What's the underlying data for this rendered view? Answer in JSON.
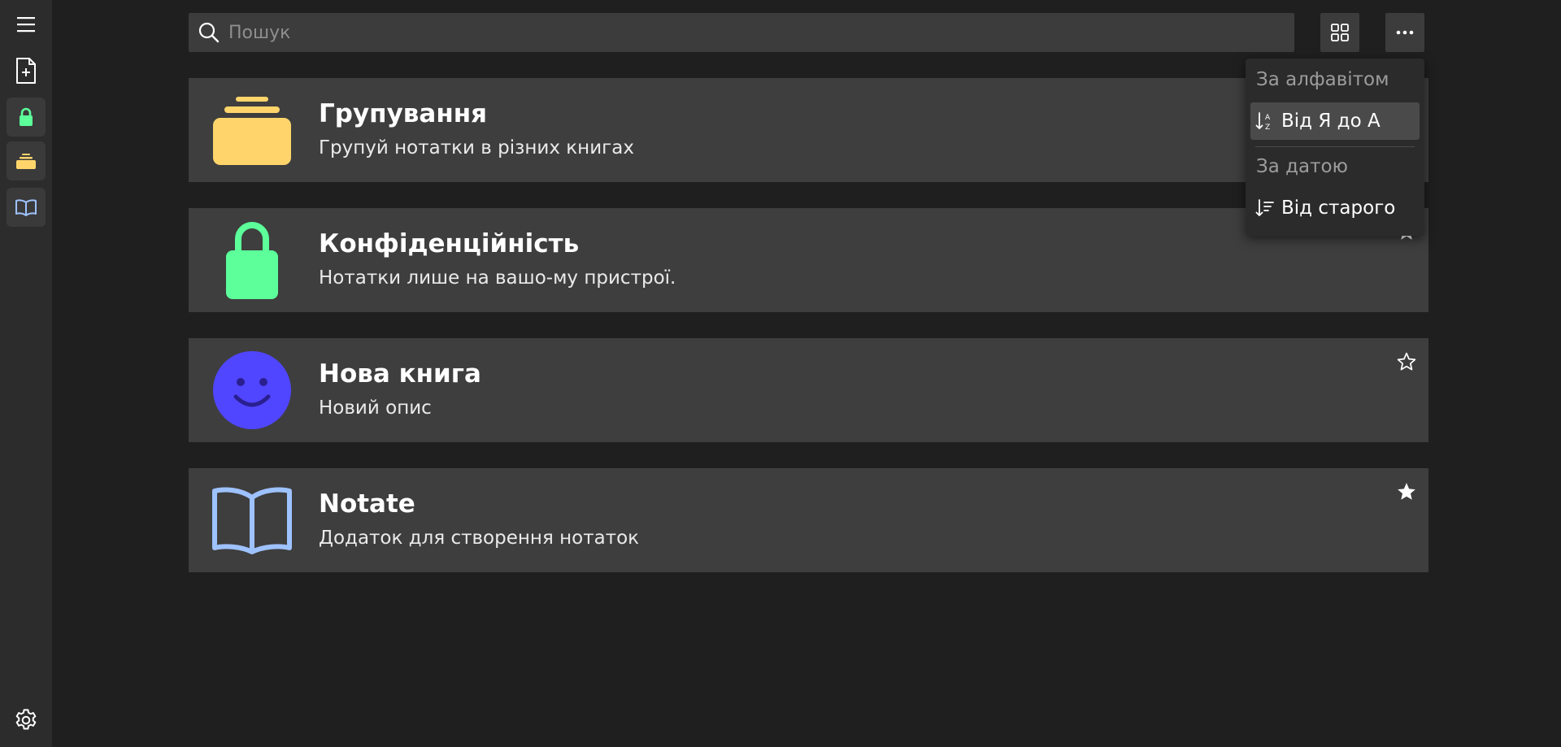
{
  "sidebar": {
    "items": [
      {
        "name": "menu",
        "icon": "hamburger-menu-icon"
      },
      {
        "name": "new-note",
        "icon": "new-document-icon"
      },
      {
        "name": "privacy-book",
        "icon": "lock-icon",
        "color": "#5cff9a"
      },
      {
        "name": "grouping-book",
        "icon": "folder-stack-icon",
        "color": "#ffd56b"
      },
      {
        "name": "notate-book",
        "icon": "open-book-icon",
        "color": "#9ec2ff"
      }
    ],
    "settings_icon": "gear-icon"
  },
  "search": {
    "placeholder": "Пошук",
    "value": ""
  },
  "toolbar": {
    "view_icon": "grid-view-icon",
    "more_icon": "more-horizontal-icon"
  },
  "books": [
    {
      "title": "Групування",
      "description": "Групуй нотатки в різних книгах",
      "icon": "folder-stack-icon",
      "color": "#ffd56b",
      "starred": true
    },
    {
      "title": "Конфіденційність",
      "description": "Нотатки лише на вашо-му пристрої.",
      "icon": "lock-icon",
      "color": "#5cff9a",
      "starred": true
    },
    {
      "title": "Нова книга",
      "description": "Новий опис",
      "icon": "smiley-face-icon",
      "color": "#5046ff",
      "starred": false
    },
    {
      "title": "Notate",
      "description": "Додаток для створення нотаток",
      "icon": "open-book-icon",
      "color": "#9ec2ff",
      "starred": true
    }
  ],
  "sort_menu": {
    "alphabet_header": "За алфавітом",
    "alphabet_option": "Від Я до А",
    "alphabet_option_icon": "sort-alpha-desc-icon",
    "date_header": "За датою",
    "date_option": "Від старого",
    "date_option_icon": "sort-date-icon"
  },
  "colors": {
    "background": "#1f1f1f",
    "sidebar": "#2c2c2c",
    "card": "#3e3e3e",
    "dropdown": "#2b2b2b",
    "active_item": "#4a4a4a"
  }
}
